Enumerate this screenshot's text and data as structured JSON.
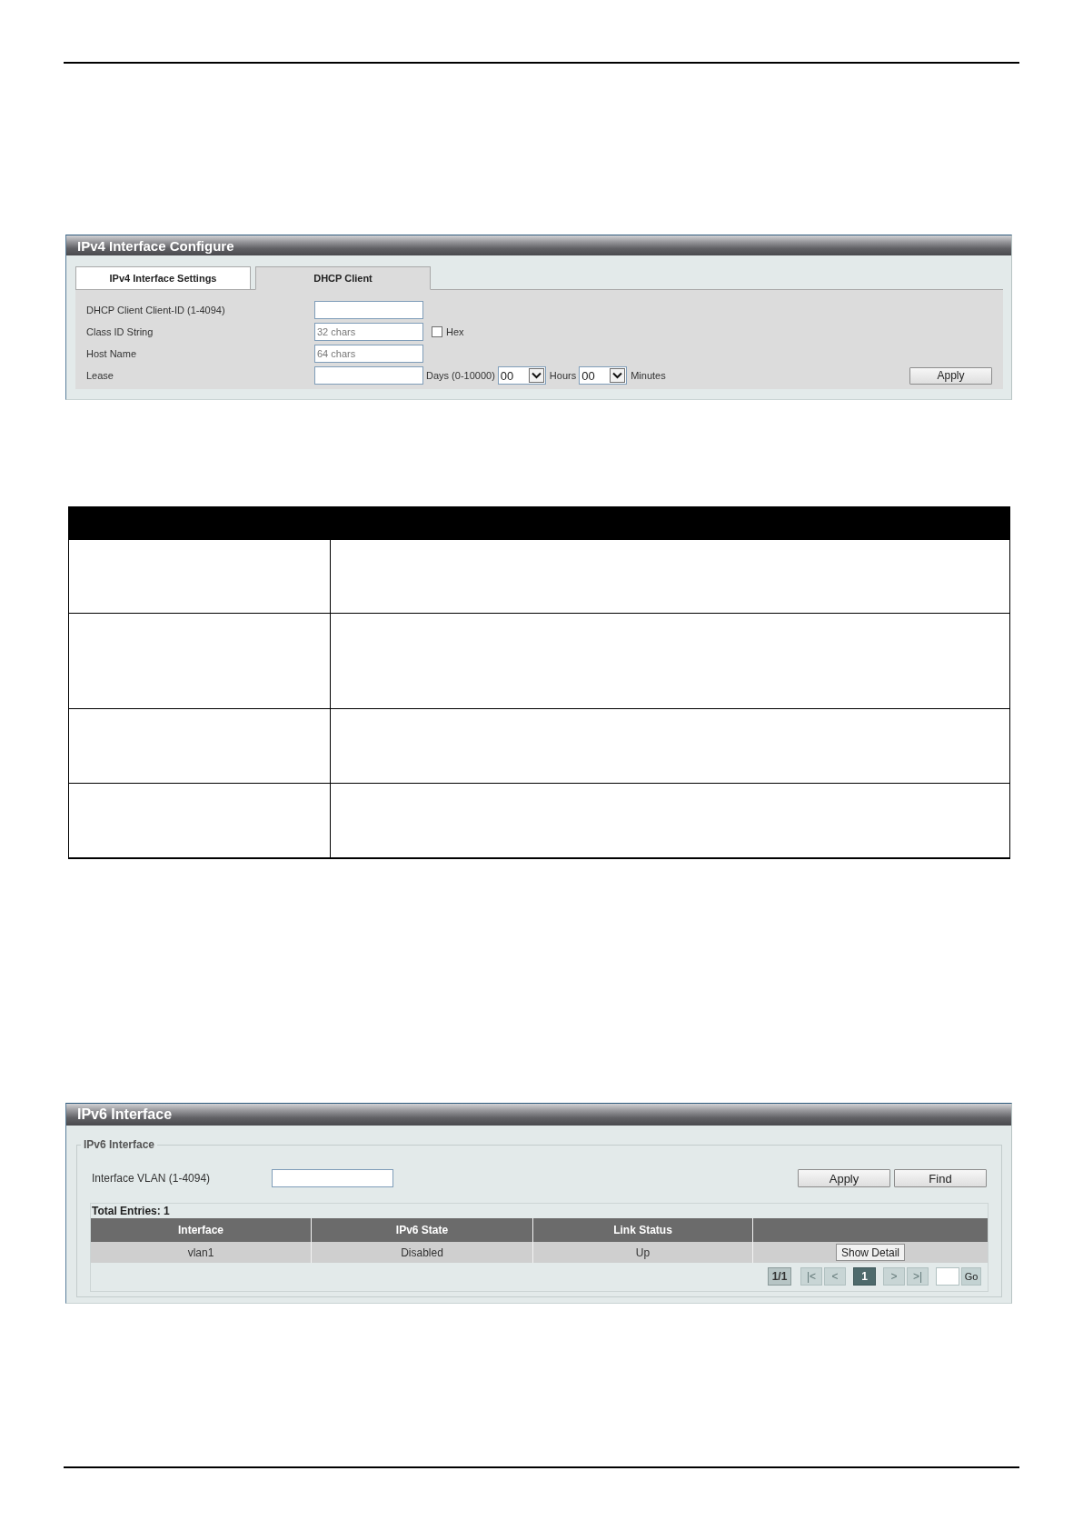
{
  "ipv4_panel": {
    "title": "IPv4 Interface Configure",
    "tabs": [
      {
        "label": "IPv4 Interface Settings",
        "selected": false
      },
      {
        "label": "DHCP Client",
        "selected": true
      }
    ],
    "fields": [
      {
        "kind": "text",
        "label": "DHCP Client Client-ID (1-4094)"
      },
      {
        "kind": "text",
        "label": "Class ID String",
        "placeholder": "32 chars",
        "checkbox": {
          "label": "Hex",
          "checked": false
        }
      },
      {
        "kind": "text",
        "label": "Host Name",
        "placeholder": "64 chars"
      },
      {
        "kind": "lease",
        "label": "Lease",
        "parts": [
          {
            "kind": "input",
            "unit": "Days (0-10000)"
          },
          {
            "kind": "select",
            "value": "00",
            "unit": "Hours"
          },
          {
            "kind": "select",
            "value": "00",
            "unit": "Minutes"
          }
        ]
      }
    ],
    "apply_button": "Apply"
  },
  "ipv6_panel": {
    "title": "IPv6 Interface",
    "group_title": "IPv6 Interface",
    "vlan_label": "Interface VLAN (1-4094)",
    "buttons": [
      "Apply",
      "Find"
    ],
    "total_entries": "Total Entries: 1",
    "table": {
      "columns": [
        "Interface",
        "IPv6 State",
        "Link Status"
      ],
      "rows": [
        {
          "cells": [
            "vlan1",
            "Disabled",
            "Up"
          ],
          "action": "Show Detail"
        }
      ]
    },
    "pagination": {
      "page_count": "1/1",
      "controls": [
        {
          "kind": "nav",
          "label": "|<",
          "disabled": true,
          "selected": false
        },
        {
          "kind": "nav",
          "label": "<",
          "disabled": true,
          "selected": false
        },
        {
          "kind": "page",
          "label": "1",
          "disabled": false,
          "selected": true
        },
        {
          "kind": "nav",
          "label": ">",
          "disabled": true,
          "selected": false
        },
        {
          "kind": "nav",
          "label": ">|",
          "disabled": true,
          "selected": false
        }
      ],
      "go_button": "Go"
    }
  }
}
